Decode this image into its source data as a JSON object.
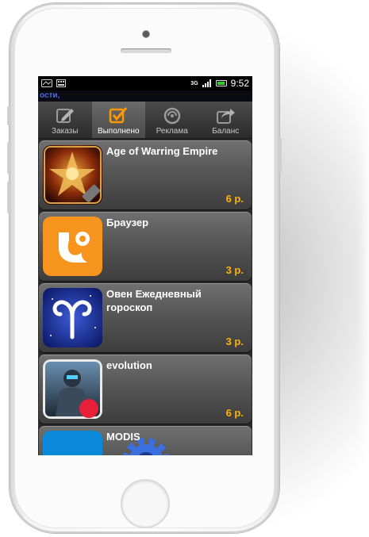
{
  "statusbar": {
    "network": "3G",
    "time": "9:52"
  },
  "ticker": {
    "text": "ости,"
  },
  "tabs": [
    {
      "label": "Заказы",
      "icon": "edit-icon",
      "active": false
    },
    {
      "label": "Выполнено",
      "icon": "checkbox-icon",
      "active": true
    },
    {
      "label": "Реклама",
      "icon": "advert-icon",
      "active": false
    },
    {
      "label": "Баланс",
      "icon": "share-icon",
      "active": false
    }
  ],
  "apps": [
    {
      "title": "Age of Warring Empire",
      "price": "6 р.",
      "icon": "age-of-warring-empire-icon"
    },
    {
      "title": "Браузер",
      "price": "3 р.",
      "icon": "uc-browser-icon"
    },
    {
      "title": "Овен Ежедневный гороскоп",
      "price": "3 р.",
      "icon": "aries-horoscope-icon"
    },
    {
      "title": "evolution",
      "price": "6 р.",
      "icon": "evolution-game-icon"
    },
    {
      "title": "MODIS",
      "price": "",
      "icon": "modis-icon"
    }
  ],
  "colors": {
    "price": "#ffb300",
    "tab_active_icon": "#ff9900",
    "ticker_text": "#4a6cf0"
  }
}
